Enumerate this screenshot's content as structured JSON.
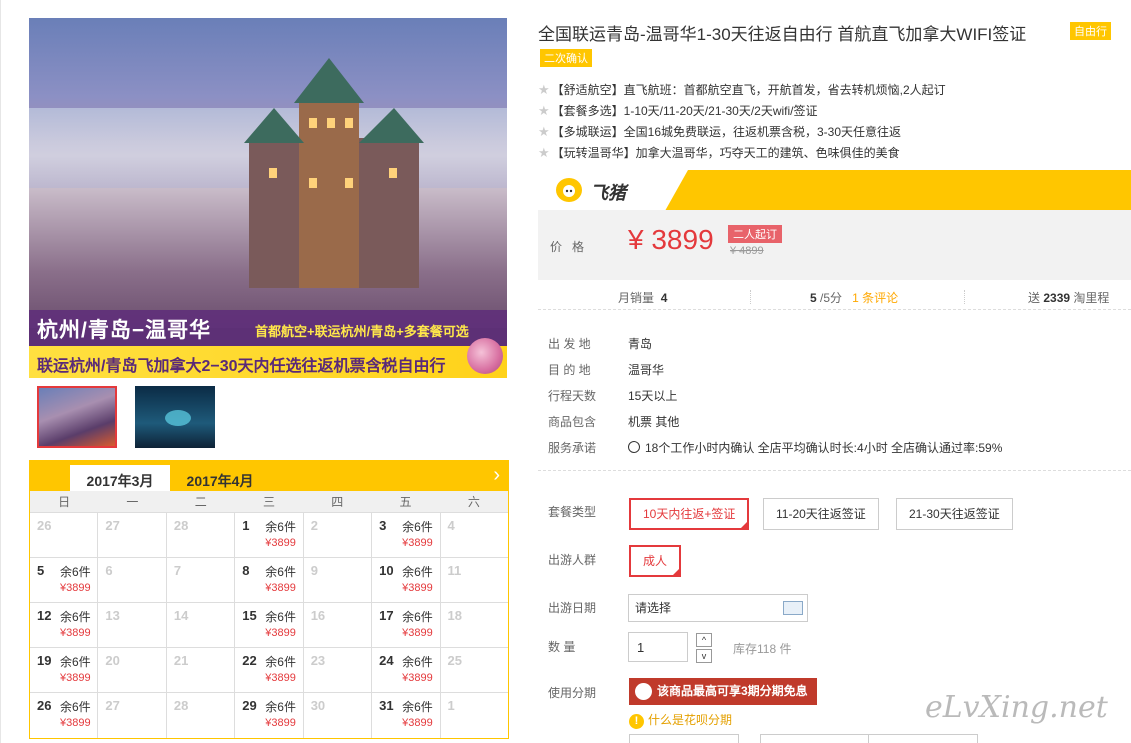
{
  "gallery": {
    "overlay_title": "杭州/青岛−温哥华",
    "overlay_sub": "首都航空+联运杭州/青岛+多套餐可选",
    "overlay_strip": "联运杭州/青岛飞加拿大2−30天内任选往返机票含税自由行"
  },
  "calendar": {
    "tabs": [
      "2017年3月",
      "2017年4月"
    ],
    "next": "›",
    "weekdays": [
      "日",
      "一",
      "二",
      "三",
      "四",
      "五",
      "六"
    ],
    "rows": [
      [
        {
          "d": "26",
          "g": true
        },
        {
          "d": "27",
          "g": true
        },
        {
          "d": "28",
          "g": true
        },
        {
          "d": "1",
          "s": "余6件",
          "p": "¥3899"
        },
        {
          "d": "2",
          "g": true
        },
        {
          "d": "3",
          "s": "余6件",
          "p": "¥3899"
        },
        {
          "d": "4",
          "g": true
        }
      ],
      [
        {
          "d": "5",
          "s": "余6件",
          "p": "¥3899"
        },
        {
          "d": "6",
          "g": true
        },
        {
          "d": "7",
          "g": true
        },
        {
          "d": "8",
          "s": "余6件",
          "p": "¥3899"
        },
        {
          "d": "9",
          "g": true
        },
        {
          "d": "10",
          "s": "余6件",
          "p": "¥3899"
        },
        {
          "d": "11",
          "g": true
        }
      ],
      [
        {
          "d": "12",
          "s": "余6件",
          "p": "¥3899"
        },
        {
          "d": "13",
          "g": true
        },
        {
          "d": "14",
          "g": true
        },
        {
          "d": "15",
          "s": "余6件",
          "p": "¥3899"
        },
        {
          "d": "16",
          "g": true
        },
        {
          "d": "17",
          "s": "余6件",
          "p": "¥3899"
        },
        {
          "d": "18",
          "g": true
        }
      ],
      [
        {
          "d": "19",
          "s": "余6件",
          "p": "¥3899"
        },
        {
          "d": "20",
          "g": true
        },
        {
          "d": "21",
          "g": true
        },
        {
          "d": "22",
          "s": "余6件",
          "p": "¥3899"
        },
        {
          "d": "23",
          "g": true
        },
        {
          "d": "24",
          "s": "余6件",
          "p": "¥3899"
        },
        {
          "d": "25",
          "g": true
        }
      ],
      [
        {
          "d": "26",
          "s": "余6件",
          "p": "¥3899"
        },
        {
          "d": "27",
          "g": true
        },
        {
          "d": "28",
          "g": true
        },
        {
          "d": "29",
          "s": "余6件",
          "p": "¥3899"
        },
        {
          "d": "30",
          "g": true
        },
        {
          "d": "31",
          "s": "余6件",
          "p": "¥3899"
        },
        {
          "d": "1",
          "g": true
        }
      ]
    ]
  },
  "product": {
    "title": "全国联运青岛-温哥华1-30天往返自由行 首航直飞加拿大WIFI签证",
    "badge_ziyou": "自由行",
    "badge_confirm": "二次确认",
    "features": [
      "【舒适航空】直飞航班：首都航空直飞，开航首发，省去转机烦恼,2人起订",
      "【套餐多选】1-10天/11-20天/21-30天/2天wifi/签证",
      "【多城联运】全国16城免费联运，往返机票含税，3-30天任意往返",
      "【玩转温哥华】加拿大温哥华，巧夺天工的建筑、色味俱佳的美食"
    ]
  },
  "price": {
    "brand": "飞猪",
    "label": "价格",
    "value": "¥ 3899",
    "tag": "二人起订",
    "old": "¥ 4899"
  },
  "stats": {
    "monthly_label": "月销量",
    "monthly_value": "4",
    "score": "5",
    "score_suffix": "/5分",
    "reviews": "1 条评论",
    "gift_prefix": "送",
    "gift_value": "2339",
    "gift_suffix": "淘里程"
  },
  "info": [
    {
      "k": "出 发 地",
      "v": "青岛"
    },
    {
      "k": "目 的 地",
      "v": "温哥华"
    },
    {
      "k": "行程天数",
      "v": "15天以上"
    },
    {
      "k": "商品包含",
      "v": "机票  其他"
    },
    {
      "k": "服务承诺",
      "v": "18个工作小时内确认    全店平均确认时长:4小时    全店确认通过率:59%"
    }
  ],
  "options": {
    "package_label": "套餐类型",
    "packages": [
      "10天内往返+签证",
      "11-20天往返签证",
      "21-30天往返签证"
    ],
    "group_label": "出游人群",
    "group": "成人",
    "date_label": "出游日期",
    "date_value": "请选择",
    "qty_label": "数    量",
    "qty_value": "1",
    "qty_up": "^",
    "qty_down": "v",
    "stock": "库存118 件",
    "installment_label": "使用分期",
    "installment_text": "该商品最高可享3期分期免息",
    "huabei_link": "什么是花呗分期"
  },
  "watermark": "eLvXing.net"
}
